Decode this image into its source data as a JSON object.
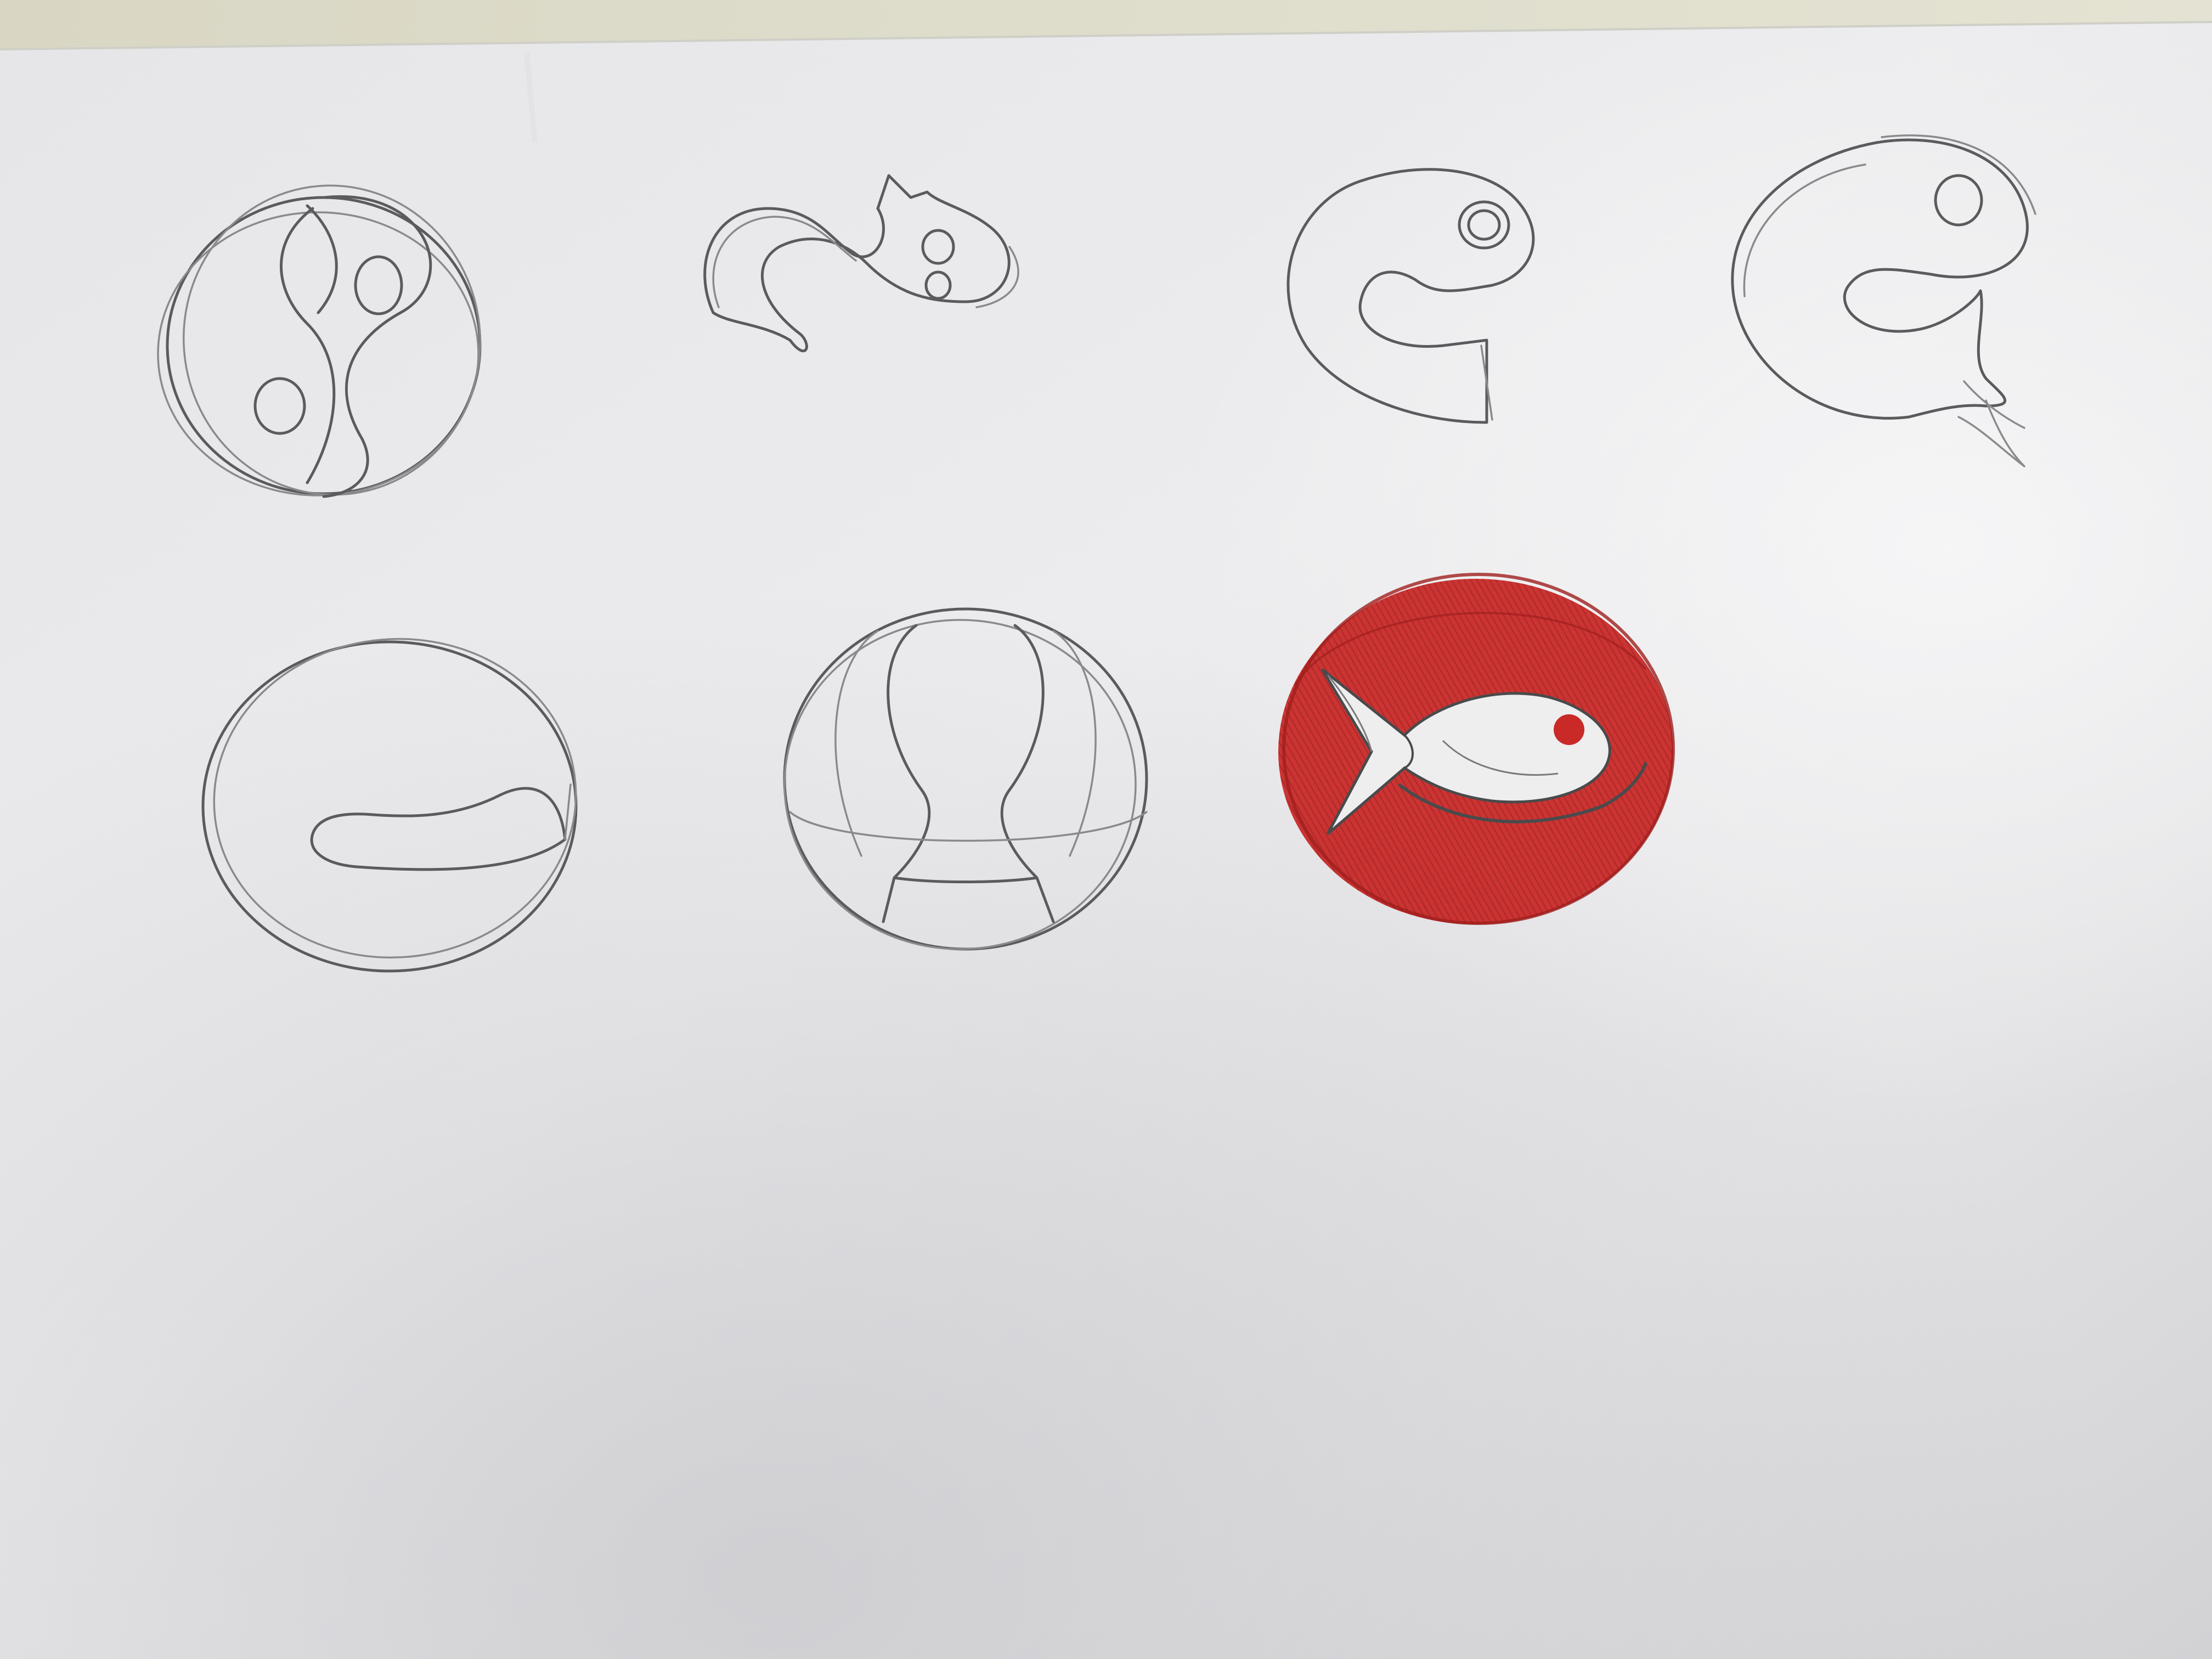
{
  "scene": {
    "subject": "sketch-sheet",
    "colors": {
      "paper_bright": "#eeeeef",
      "paper_mid": "#e2e2e4",
      "paper_shadow": "#c9c9cc",
      "backdrop": "#d6d4c6",
      "pencil": "#5b5b5e",
      "pencil_light": "#8a8a8d",
      "red_pencil": "#c92a28",
      "red_dark": "#9f1f1e"
    }
  },
  "sketches": [
    {
      "id": 1,
      "motif": "yin-yang-fish-circle",
      "medium": "graphite"
    },
    {
      "id": 2,
      "motif": "wave-fish",
      "medium": "graphite"
    },
    {
      "id": 3,
      "motif": "curled-fish",
      "medium": "graphite"
    },
    {
      "id": 4,
      "motif": "curled-fish-with-tail",
      "medium": "graphite"
    },
    {
      "id": 5,
      "motif": "circle-with-fin",
      "medium": "graphite"
    },
    {
      "id": 6,
      "motif": "circle-with-arch",
      "medium": "graphite"
    },
    {
      "id": 7,
      "motif": "red-fish-emblem",
      "medium": "red-pencil"
    }
  ]
}
